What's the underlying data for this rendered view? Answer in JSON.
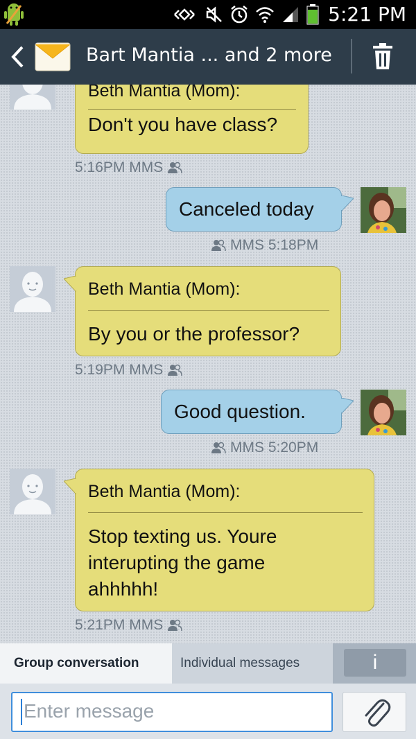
{
  "status_bar": {
    "time": "5:21 PM",
    "icons": [
      "android-debug-icon",
      "nfc-icon",
      "mute-icon",
      "alarm-icon",
      "wifi-icon",
      "signal-icon",
      "battery-icon"
    ]
  },
  "action_bar": {
    "title": "Bart Mantia ... and 2 more",
    "back_icon": "chevron-left-icon",
    "app_icon": "envelope-icon",
    "delete_icon": "trash-icon"
  },
  "messages": [
    {
      "direction": "in",
      "sender": "Beth Mantia (Mom):",
      "text": "Don't you have class?",
      "meta": "5:16PM MMS"
    },
    {
      "direction": "out",
      "text": "Canceled today",
      "meta": "MMS 5:18PM"
    },
    {
      "direction": "in",
      "sender": "Beth Mantia (Mom):",
      "text": "By you or the professor?",
      "meta": "5:19PM MMS"
    },
    {
      "direction": "out",
      "text": "Good question.",
      "meta": "MMS 5:20PM"
    },
    {
      "direction": "in",
      "sender": "Beth Mantia (Mom):",
      "text_lines": [
        "Stop texting us. Youre",
        "interupting the game",
        "ahhhhh!"
      ],
      "meta": "5:21PM MMS"
    }
  ],
  "tabs": {
    "group": "Group conversation",
    "individual": "Individual messages",
    "info": "i"
  },
  "compose": {
    "placeholder": "Enter message",
    "attach_icon": "paperclip-icon"
  },
  "colors": {
    "action_bar": "#2e3d4a",
    "incoming_bubble": "#e5dd7a",
    "outgoing_bubble": "#a4d0e8",
    "background": "#d7dce2",
    "input_border": "#3f8edc"
  }
}
